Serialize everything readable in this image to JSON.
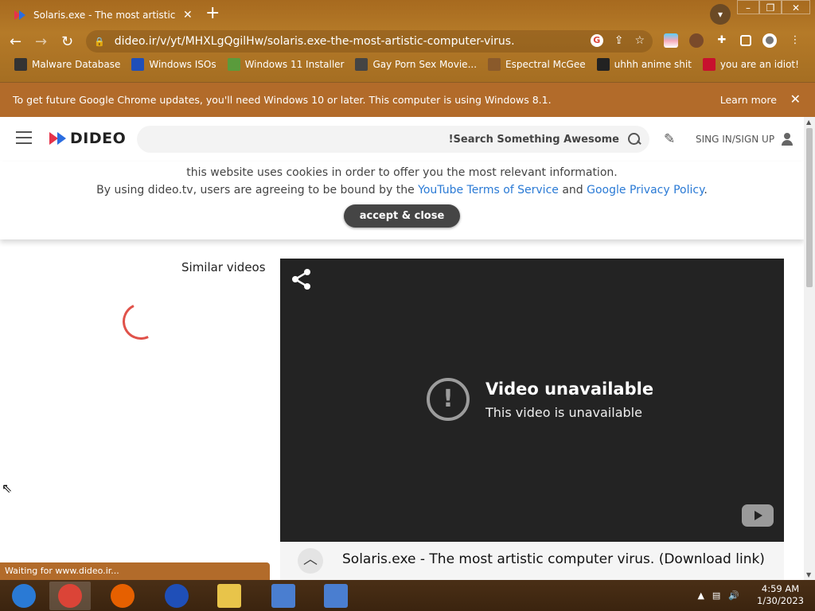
{
  "browser": {
    "tab_title": "Solaris.exe - The most artistic co",
    "tab_close": "✕",
    "new_tab": "+",
    "url": "dideo.ir/v/yt/MHXLgQgilHw/solaris.exe-the-most-artistic-computer-virus.",
    "window_controls": [
      "–",
      "❐",
      "✕"
    ],
    "bookmarks": [
      {
        "label": "Malware Database",
        "icon": "skull-icon",
        "color": "#333333"
      },
      {
        "label": "Windows ISOs",
        "icon": "x-logo-icon",
        "color": "#1f4fb8"
      },
      {
        "label": "Windows 11 Installer",
        "icon": "image-icon",
        "color": "#5a9b3c"
      },
      {
        "label": "Gay Porn Sex Movie...",
        "icon": "globe-icon",
        "color": "#444444"
      },
      {
        "label": "Espectral McGee",
        "icon": "face-icon",
        "color": "#8a5a2b"
      },
      {
        "label": "uhhh anime shit",
        "icon": "panda-icon",
        "color": "#222222"
      },
      {
        "label": "you are an idiot!",
        "icon": "flag-icon",
        "color": "#c8102e"
      }
    ]
  },
  "update_bar": {
    "message": "To get future Google Chrome updates, you'll need Windows 10 or later. This computer is using Windows 8.1.",
    "learn_more": "Learn more",
    "close": "✕"
  },
  "site": {
    "logo_text": "DIDEO",
    "search_placeholder": "!Search Something Awesome",
    "sign_in": "SING IN/SIGN UP"
  },
  "cookie": {
    "line1": "this website uses cookies in order to offer you the most relevant information.",
    "line2_prefix": "By using dideo.tv, users are agreeing to be bound by the",
    "link1": "YouTube Terms of Service",
    "and": "and",
    "link2": "Google Privacy Policy",
    "line2_suffix": ".",
    "accept": "accept & close"
  },
  "sidebar": {
    "similar_label": "Similar videos"
  },
  "player": {
    "unavailable_title": "Video unavailable",
    "unavailable_sub": "This video is unavailable",
    "warn_glyph": "!"
  },
  "video": {
    "title": "Solaris.exe - The most artistic computer virus. (Download link)",
    "collapse_glyph": "︿"
  },
  "status_bar": {
    "text": "Waiting for www.dideo.ir..."
  },
  "taskbar": {
    "apps": [
      {
        "name": "start",
        "color": "#2a7ad5"
      },
      {
        "name": "chrome",
        "color": "#db4437"
      },
      {
        "name": "firefox",
        "color": "#e66000"
      },
      {
        "name": "obama-logo",
        "color": "#1f4fb8"
      },
      {
        "name": "file-explorer",
        "color": "#e8c44a"
      },
      {
        "name": "installer-1",
        "color": "#4a7ed0"
      },
      {
        "name": "installer-2",
        "color": "#4a7ed0"
      }
    ],
    "time": "4:59 AM",
    "date": "1/30/2023"
  }
}
